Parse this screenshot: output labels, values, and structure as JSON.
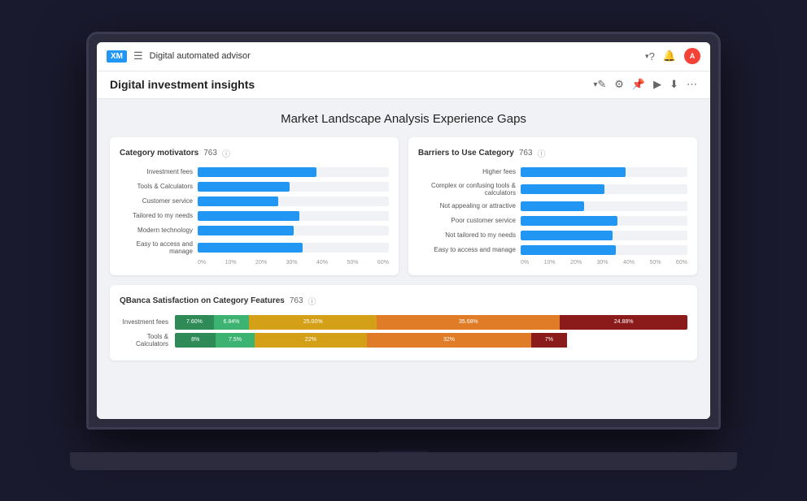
{
  "topbar": {
    "logo": "XM",
    "nav_title": "Digital automated advisor",
    "chevron": "▾"
  },
  "subbar": {
    "page_title": "Digital investment insights",
    "chevron": "▾"
  },
  "main": {
    "chart_main_title": "Market Landscape Analysis Experience Gaps",
    "left_card": {
      "title": "Category motivators",
      "count": "763",
      "bars": [
        {
          "label": "Investment fees",
          "pct": 62
        },
        {
          "label": "Tools & Calculators",
          "pct": 48
        },
        {
          "label": "Customer service",
          "pct": 42
        },
        {
          "label": "Tailored to my needs",
          "pct": 53
        },
        {
          "label": "Modern technology",
          "pct": 50
        },
        {
          "label": "Easy to access and manage",
          "pct": 55
        }
      ],
      "axis": [
        "0%",
        "10%",
        "20%",
        "30%",
        "40%",
        "50%",
        "60%"
      ]
    },
    "right_card": {
      "title": "Barriers to Use Category",
      "count": "763",
      "bars": [
        {
          "label": "Higher fees",
          "pct": 63
        },
        {
          "label": "Complex or confusing tools & calculators",
          "pct": 50
        },
        {
          "label": "Not appealing or attractive",
          "pct": 38
        },
        {
          "label": "Poor customer service",
          "pct": 58
        },
        {
          "label": "Not tailored to my needs",
          "pct": 55
        },
        {
          "label": "Easy to access and manage",
          "pct": 57
        }
      ],
      "axis": [
        "0%",
        "10%",
        "20%",
        "30%",
        "40%",
        "50%",
        "60%"
      ]
    },
    "satisfaction_card": {
      "title": "QBanca Satisfaction on Category Features",
      "count": "763",
      "rows": [
        {
          "label": "Investment fees",
          "segments": [
            {
              "pct": 7.6,
              "color": "#2e8b57",
              "text": "7.60%"
            },
            {
              "pct": 6.84,
              "color": "#3cb371",
              "text": "6.84%"
            },
            {
              "pct": 25.0,
              "color": "#d4a017",
              "text": "25.00%"
            },
            {
              "pct": 35.68,
              "color": "#e07b28",
              "text": "35.68%"
            },
            {
              "pct": 24.88,
              "color": "#8b1a1a",
              "text": "24.88%"
            }
          ]
        },
        {
          "label": "Tools & Calculators",
          "segments": [
            {
              "pct": 8.0,
              "color": "#2e8b57",
              "text": "8%"
            },
            {
              "pct": 7.5,
              "color": "#3cb371",
              "text": "7.5%"
            },
            {
              "pct": 22.0,
              "color": "#d4a017",
              "text": "22%"
            },
            {
              "pct": 32.0,
              "color": "#e07b28",
              "text": "32%"
            },
            {
              "pct": 7.0,
              "color": "#8b1a1a",
              "text": "7%"
            }
          ]
        }
      ]
    }
  },
  "icons": {
    "hamburger": "☰",
    "help": "?",
    "bell": "🔔",
    "edit": "✎",
    "settings": "⚙",
    "pin": "📌",
    "play": "▶",
    "download": "⬇",
    "share": "⋯",
    "info": "ⓘ"
  }
}
